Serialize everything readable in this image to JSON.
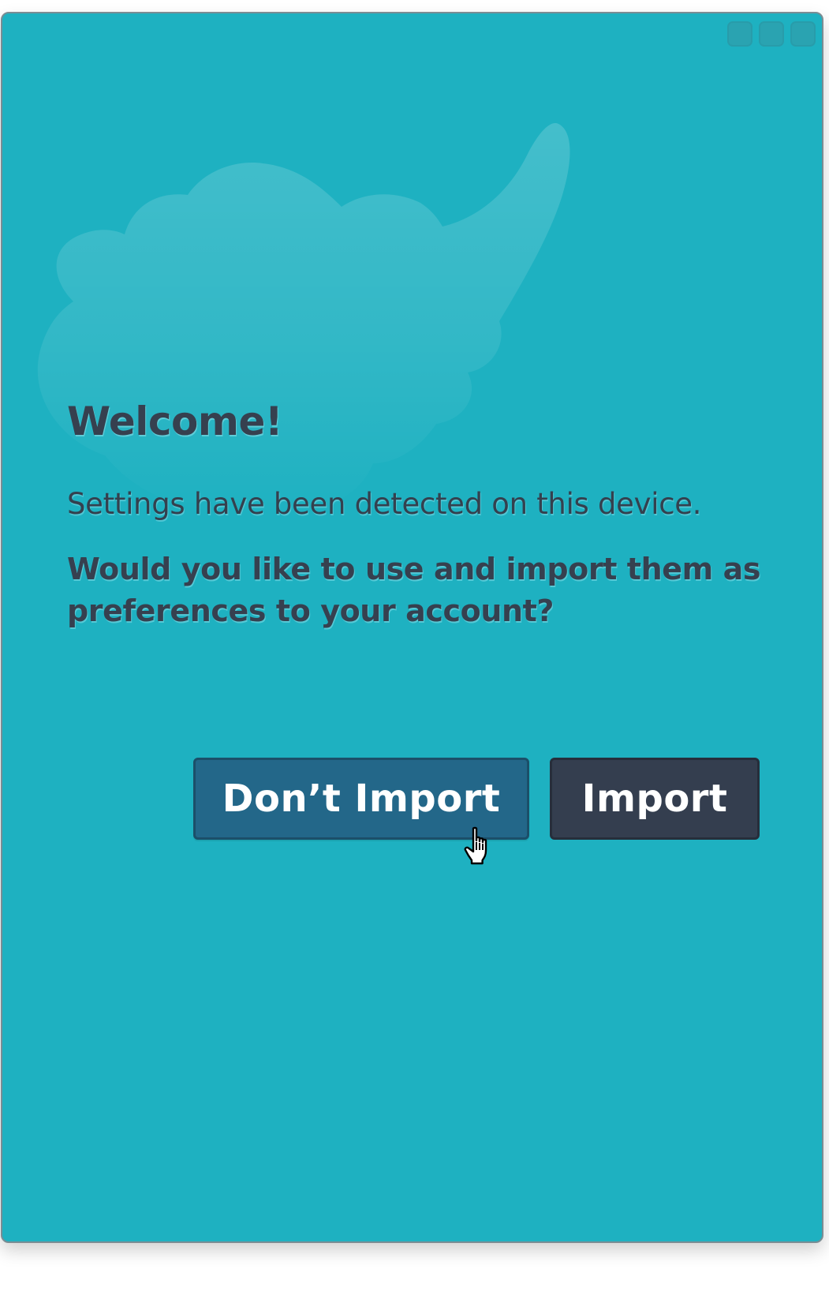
{
  "dialog": {
    "title": "Welcome!",
    "message": "Settings have been detected on this device.",
    "question": "Would you like to use and import them as preferences to your account?"
  },
  "buttons": {
    "dont_import_label": "Don’t Import",
    "import_label": "Import"
  },
  "colors": {
    "background": "#1eb1c1",
    "primary_text": "#36404f",
    "dont_import_button": "#236789",
    "import_button": "#343e4f"
  },
  "icons": {
    "window_controls": [
      "minimize-icon",
      "maximize-icon",
      "close-icon"
    ],
    "background_mascot": "mascot-silhouette",
    "cursor": "hand-pointer-icon"
  }
}
